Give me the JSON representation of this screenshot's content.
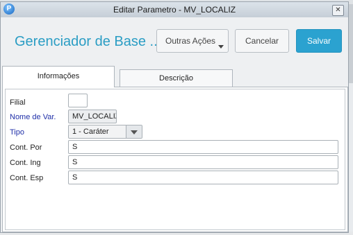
{
  "window": {
    "title": "Editar Parametro - MV_LOCALIZ",
    "close_glyph": "✕",
    "app_icon_glyph": "P"
  },
  "header": {
    "app_title": "Gerenciador de Base ...",
    "more_actions_label": "Outras Ações",
    "cancel_label": "Cancelar",
    "save_label": "Salvar"
  },
  "tabs": [
    {
      "label": "Informações",
      "selected": true
    },
    {
      "label": "Descrição",
      "selected": false
    }
  ],
  "form": {
    "filial": {
      "label": "Filial",
      "value": ""
    },
    "nome_var": {
      "label": "Nome de Var.",
      "value": "MV_LOCALIZ"
    },
    "tipo": {
      "label": "Tipo",
      "value": "1 - Caráter"
    },
    "cont_por": {
      "label": "Cont. Por",
      "value": "S"
    },
    "cont_ing": {
      "label": "Cont. Ing",
      "value": "S"
    },
    "cont_esp": {
      "label": "Cont. Esp",
      "value": "S"
    }
  },
  "colors": {
    "accent": "#2ba2d0",
    "title_blue": "#2a9dc4",
    "required_label": "#1f2fa8"
  },
  "icons": {
    "app": "protheus-logo-icon",
    "close": "close-icon",
    "dropdown": "chevron-down-icon"
  }
}
